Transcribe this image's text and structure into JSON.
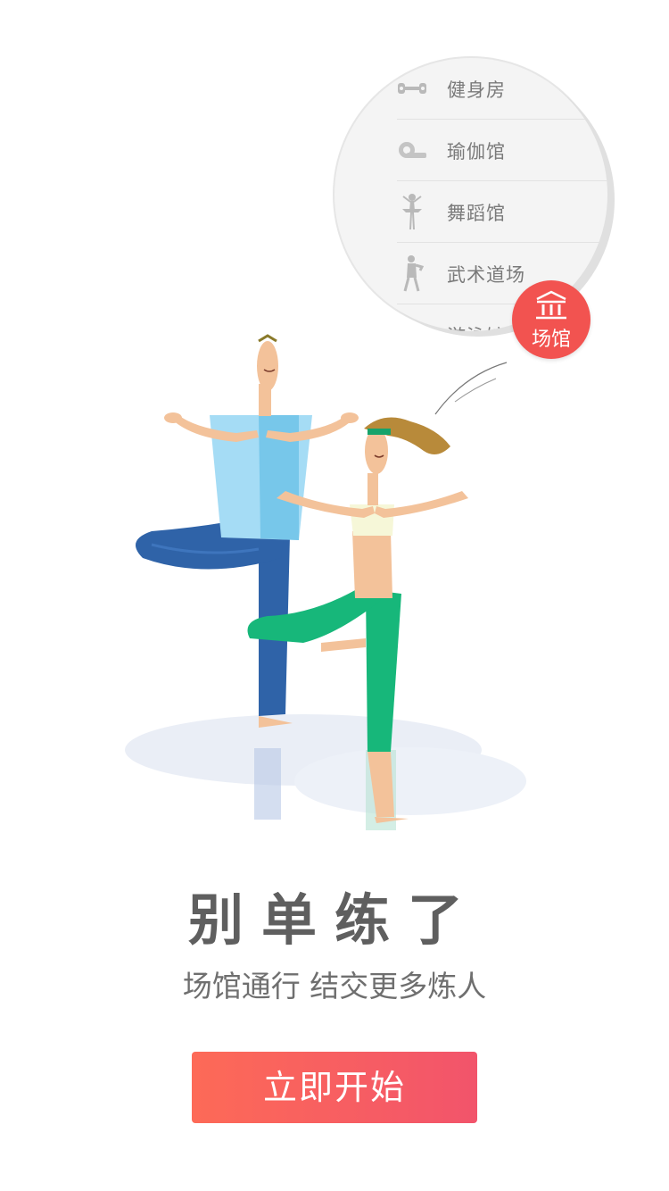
{
  "venues": [
    {
      "label": "健身房",
      "icon": "dumbbell-icon"
    },
    {
      "label": "瑜伽馆",
      "icon": "yoga-mat-icon"
    },
    {
      "label": "舞蹈馆",
      "icon": "ballet-dancer-icon"
    },
    {
      "label": "武术道场",
      "icon": "martial-arts-icon"
    },
    {
      "label": "游泳馆",
      "icon": "swimming-icon"
    }
  ],
  "badge": {
    "label": "场馆",
    "icon": "building-icon"
  },
  "title": "别单练了",
  "subtitle": "场馆通行 结交更多炼人",
  "cta_label": "立即开始",
  "colors": {
    "accent": "#f25350",
    "button_start": "#fd6a57",
    "button_end": "#f2546b",
    "title_text": "#5f5f5f"
  }
}
